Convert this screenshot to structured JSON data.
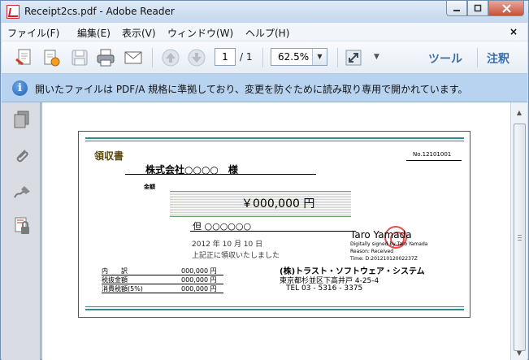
{
  "window": {
    "title": "Receipt2cs.pdf - Adobe Reader"
  },
  "menubar": {
    "items": [
      "ファイル(F)",
      "編集(E)",
      "表示(V)",
      "ウィンドウ(W)",
      "ヘルプ(H)"
    ],
    "close_glyph": "×"
  },
  "toolbar": {
    "page_current": "1",
    "page_total": "/ 1",
    "zoom": "62.5%",
    "tools_label": "ツール",
    "comment_label": "注釈",
    "icons": [
      "create-pdf-icon",
      "sign-export-icon",
      "save-icon",
      "print-icon",
      "email-icon",
      "previous-page-icon",
      "next-page-icon",
      "fit-page-icon"
    ]
  },
  "infobar": {
    "text": "開いたファイルは PDF/A 規格に準拠しており、変更を防ぐために読み取り専用で開かれています。"
  },
  "navpanel": {
    "icons": [
      "page-thumbnails-icon",
      "attachments-icon",
      "signatures-icon",
      "security-icon"
    ]
  },
  "receipt": {
    "title": "領収書",
    "number": "No.12101001",
    "addressee": "株式会社○○○○　様",
    "amount_label": "金額",
    "amount": "￥000,000 円",
    "memo": "但 ○○○○○○",
    "date": "2012 年 10 月 10 日",
    "received": "上記正に領収いたしました",
    "breakdown": [
      {
        "label": "内　　訳",
        "value": "000,000 円"
      },
      {
        "label": "税抜金額",
        "value": "000,000 円"
      },
      {
        "label": "消費税額(5%)",
        "value": "000,000 円"
      }
    ],
    "company": "(株)トラスト・ソフトウェア・システム",
    "address": "東京都杉並区下高井戸 4-25-4",
    "tel": "TEL 03 - 5316 - 3375"
  },
  "signature": {
    "name": "Taro Yamada",
    "lines": [
      "Digitally signed by Taro Yamada",
      "Reason: Received",
      "Time: D:20121012002237Z"
    ]
  },
  "colors": {
    "accent_teal": "#2b8f8f",
    "link_blue": "#3a6fa8",
    "infobar_bg": "#b7d3ef"
  }
}
